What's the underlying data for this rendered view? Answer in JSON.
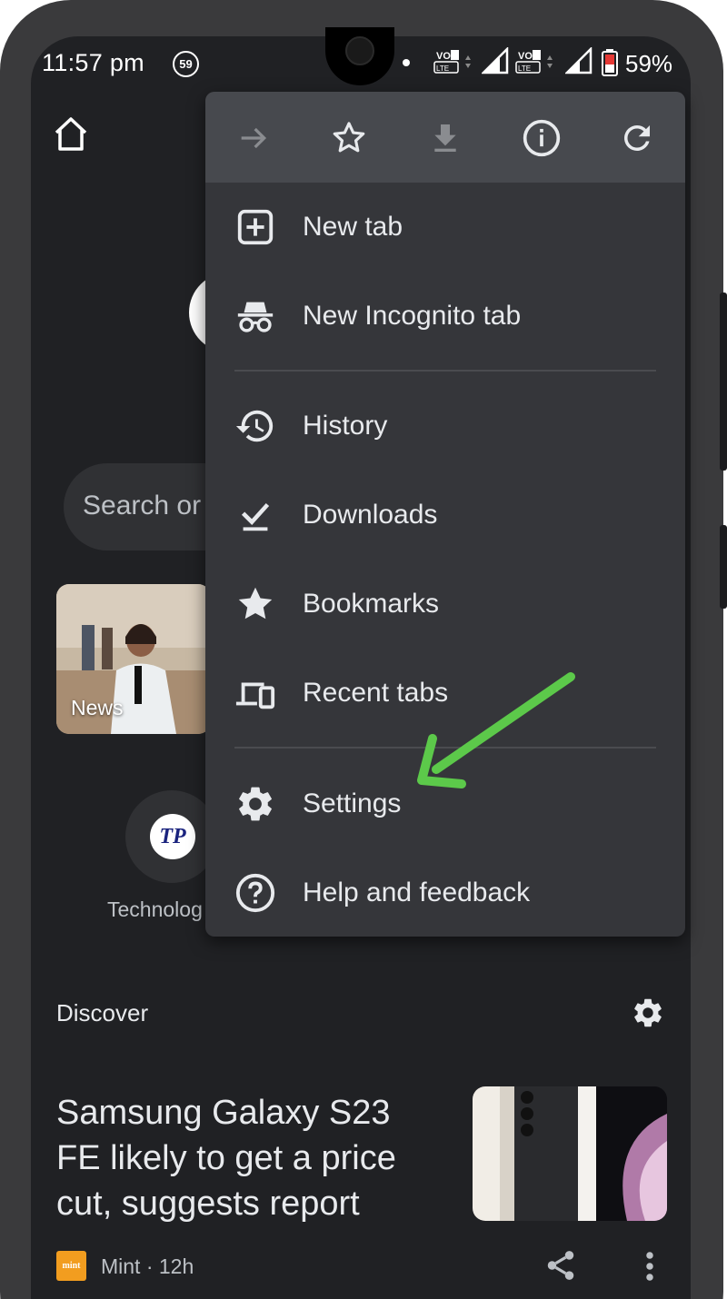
{
  "status_bar": {
    "time": "11:57 pm",
    "notification_count": "59",
    "battery_percent": "59%"
  },
  "page": {
    "search_placeholder": "Search or",
    "tiles": [
      {
        "label": "News"
      },
      {
        "label": "Technolog",
        "logo_text": "TP"
      }
    ],
    "discover": {
      "label": "Discover"
    },
    "article": {
      "title": "Samsung Galaxy S23 FE likely to get a price cut, suggests report",
      "source_logo": "mint",
      "source": "Mint · 12h"
    }
  },
  "menu": {
    "toolbar": [
      "forward-icon",
      "bookmark-star-icon",
      "download-icon",
      "info-icon",
      "refresh-icon"
    ],
    "items": [
      {
        "label": "New tab",
        "icon": "new-tab-icon"
      },
      {
        "label": "New Incognito tab",
        "icon": "incognito-icon"
      },
      {
        "label": "History",
        "icon": "history-icon"
      },
      {
        "label": "Downloads",
        "icon": "downloads-icon"
      },
      {
        "label": "Bookmarks",
        "icon": "bookmarks-icon"
      },
      {
        "label": "Recent tabs",
        "icon": "recent-tabs-icon"
      },
      {
        "label": "Settings",
        "icon": "settings-icon"
      },
      {
        "label": "Help and feedback",
        "icon": "help-icon"
      }
    ]
  },
  "annotation": {
    "arrow_color": "#5cc94a"
  },
  "colors": {
    "background": "#202124",
    "menu": "#35363a",
    "menu_toolbar": "#47494e",
    "text": "#e8eaed"
  }
}
